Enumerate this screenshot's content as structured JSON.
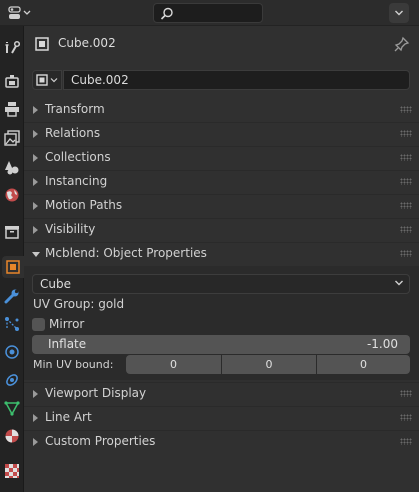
{
  "header": {
    "editor_type_icon": "properties-editor-icon",
    "search_icon": "search-icon",
    "options_icon": "chevron-down-icon"
  },
  "tabs": [
    {
      "name": "tool-tab",
      "icon": "wrench-screwdriver-icon"
    },
    {
      "name": "render-tab",
      "icon": "camera-back-icon"
    },
    {
      "name": "output-tab",
      "icon": "printer-icon"
    },
    {
      "name": "view-layer-tab",
      "icon": "image-stack-icon"
    },
    {
      "name": "scene-tab",
      "icon": "scene-cone-sphere-icon"
    },
    {
      "name": "world-tab",
      "icon": "world-globe-icon"
    },
    {
      "name": "collection-tab",
      "icon": "collection-box-icon"
    },
    {
      "name": "object-tab",
      "icon": "object-square-icon",
      "active": true
    },
    {
      "name": "modifier-tab",
      "icon": "wrench-icon"
    },
    {
      "name": "particles-tab",
      "icon": "particles-icon"
    },
    {
      "name": "physics-tab",
      "icon": "physics-orbit-icon"
    },
    {
      "name": "constraints-tab",
      "icon": "constraint-icon"
    },
    {
      "name": "data-tab",
      "icon": "mesh-triangle-icon"
    },
    {
      "name": "material-tab",
      "icon": "material-sphere-icon"
    },
    {
      "name": "texture-tab",
      "icon": "checker-texture-icon"
    }
  ],
  "object": {
    "header_name": "Cube.002",
    "name_field": "Cube.002"
  },
  "panels": {
    "transform": "Transform",
    "relations": "Relations",
    "collections": "Collections",
    "instancing": "Instancing",
    "motion_paths": "Motion Paths",
    "visibility": "Visibility",
    "mcblend": "Mcblend: Object Properties",
    "viewport_display": "Viewport Display",
    "line_art": "Line Art",
    "custom_properties": "Custom Properties"
  },
  "mcblend": {
    "mesh_type": "Cube",
    "uv_group": "UV Group: gold",
    "mirror_label": "Mirror",
    "mirror_checked": false,
    "inflate_label": "Inflate",
    "inflate_value": "-1.00",
    "min_uv_label": "Min UV bound:",
    "min_uv": [
      "0",
      "0",
      "0"
    ]
  },
  "colors": {
    "accent_orange": "#e8862a",
    "tool_blue": "#4a90d9",
    "background": "#303030"
  }
}
